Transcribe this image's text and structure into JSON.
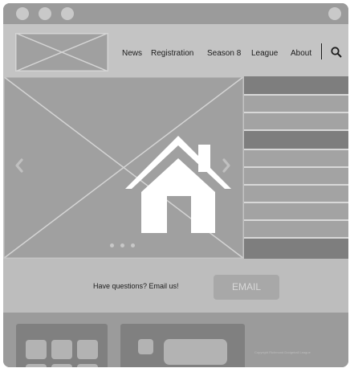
{
  "nav": {
    "links": [
      "News",
      "Registration",
      "Season 8",
      "League",
      "About"
    ]
  },
  "icons": {
    "logo": "logo-placeholder-image",
    "search": "search-icon",
    "home": "home-icon",
    "carousel_prev": "chevron-left-icon",
    "carousel_next": "chevron-right-icon"
  },
  "hero": {
    "slides_count": 3,
    "active_slide": 1
  },
  "cta": {
    "text": "Have questions? Email us!",
    "button_label": "EMAIL"
  },
  "footer": {
    "copyright": "Copyright Richmond Dodgeball League"
  },
  "colors": {
    "window": "#9b9b9b",
    "navbar": "#c4c4c4",
    "hero": "#a0a0a0",
    "cta_band": "#bdbdbd",
    "button": "#a8a8a8",
    "icon": "#ffffff"
  }
}
